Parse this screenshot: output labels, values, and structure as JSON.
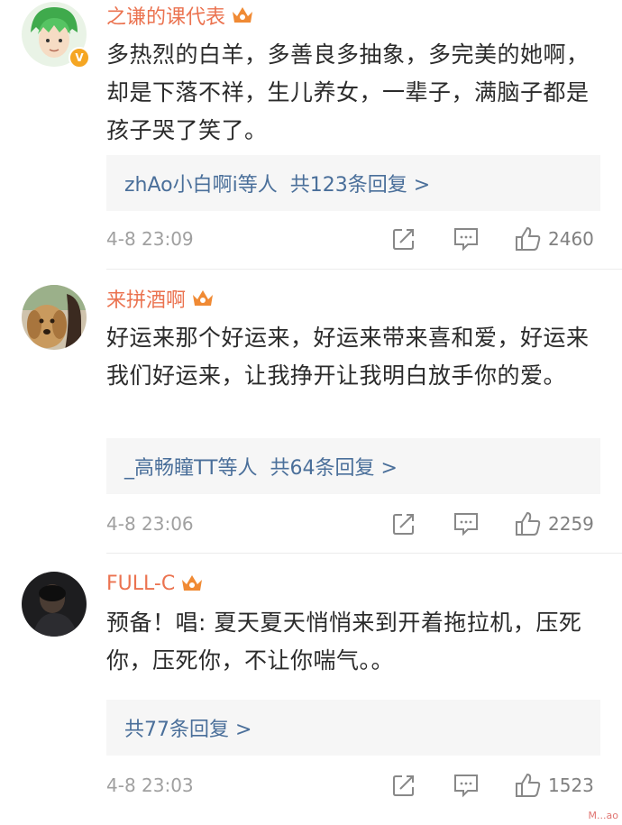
{
  "comments": [
    {
      "username": "之谦的课代表",
      "text": "多热烈的白羊，多善良多抽象，多完美的她啊，却是下落不祥，生儿养女，一辈子，满脑子都是孩子哭了笑了。",
      "reply_prefix": "zhAo小白啊i等人",
      "reply_count": "共123条回复 >",
      "timestamp": "4-8 23:09",
      "likes": "2460",
      "avatar": "green-hair-anime-avatar",
      "verified": true
    },
    {
      "username": "来拼酒啊",
      "text": "好运来那个好运来，好运来带来喜和爱，好运来我们好运来，让我挣开让我明白放手你的爱。",
      "reply_prefix": "_高畅瞳TT等人",
      "reply_count": "共64条回复 >",
      "timestamp": "4-8 23:06",
      "likes": "2259",
      "avatar": "dog-photo-avatar",
      "verified": false
    },
    {
      "username": "FULL-C",
      "text": "预备！唱: 夏天夏天悄悄来到开着拖拉机，压死你，压死你，不让你喘气。。",
      "reply_prefix": "",
      "reply_count": "共77条回复 >",
      "timestamp": "4-8 23:03",
      "likes": "1523",
      "avatar": "dark-photo-avatar",
      "verified": false
    }
  ],
  "icons": {
    "member": "crown-icon",
    "share": "share-icon",
    "comment": "comment-icon",
    "like": "thumbs-up-icon"
  },
  "colors": {
    "username": "#eb7350",
    "reply_link": "#4a6f9a",
    "meta": "#a0a0a0"
  },
  "watermark": "M...ao"
}
